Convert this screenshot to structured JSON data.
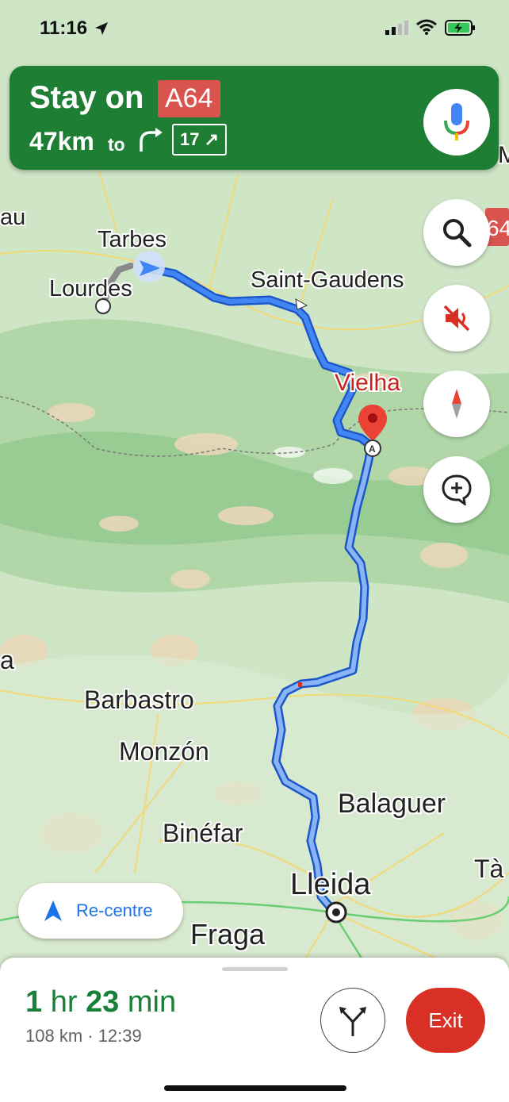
{
  "status_bar": {
    "time": "11:16"
  },
  "banner": {
    "instruction": "Stay on",
    "road": "A64",
    "distance": "47km",
    "to": "to",
    "exit_number": "17 ↗",
    "turn_icon": "turn-right-icon"
  },
  "map": {
    "labels": [
      "Tarbes",
      "Lourdes",
      "Saint-Gaudens",
      "Vielha",
      "Barbastro",
      "Monzón",
      "Binéfar",
      "Balaguer",
      "Lleida",
      "Fraga",
      "Tà",
      "au",
      "a",
      "64",
      "M"
    ],
    "destination_marker": "A"
  },
  "controls": {
    "search": "search-icon",
    "mute": "sound-off-icon",
    "compass": "compass-icon",
    "report": "add-report-icon"
  },
  "recentre": {
    "label": "Re-centre"
  },
  "trip": {
    "hr": "1",
    "hr_unit": " hr ",
    "min": "23",
    "min_unit": " min",
    "details": "108 km · 12:39",
    "exit_label": "Exit",
    "alt_routes_icon": "alternate-routes-icon"
  },
  "colors": {
    "banner": "#1e7e34",
    "route": "#4285f4",
    "exit": "#d93025",
    "eta": "#188038"
  }
}
